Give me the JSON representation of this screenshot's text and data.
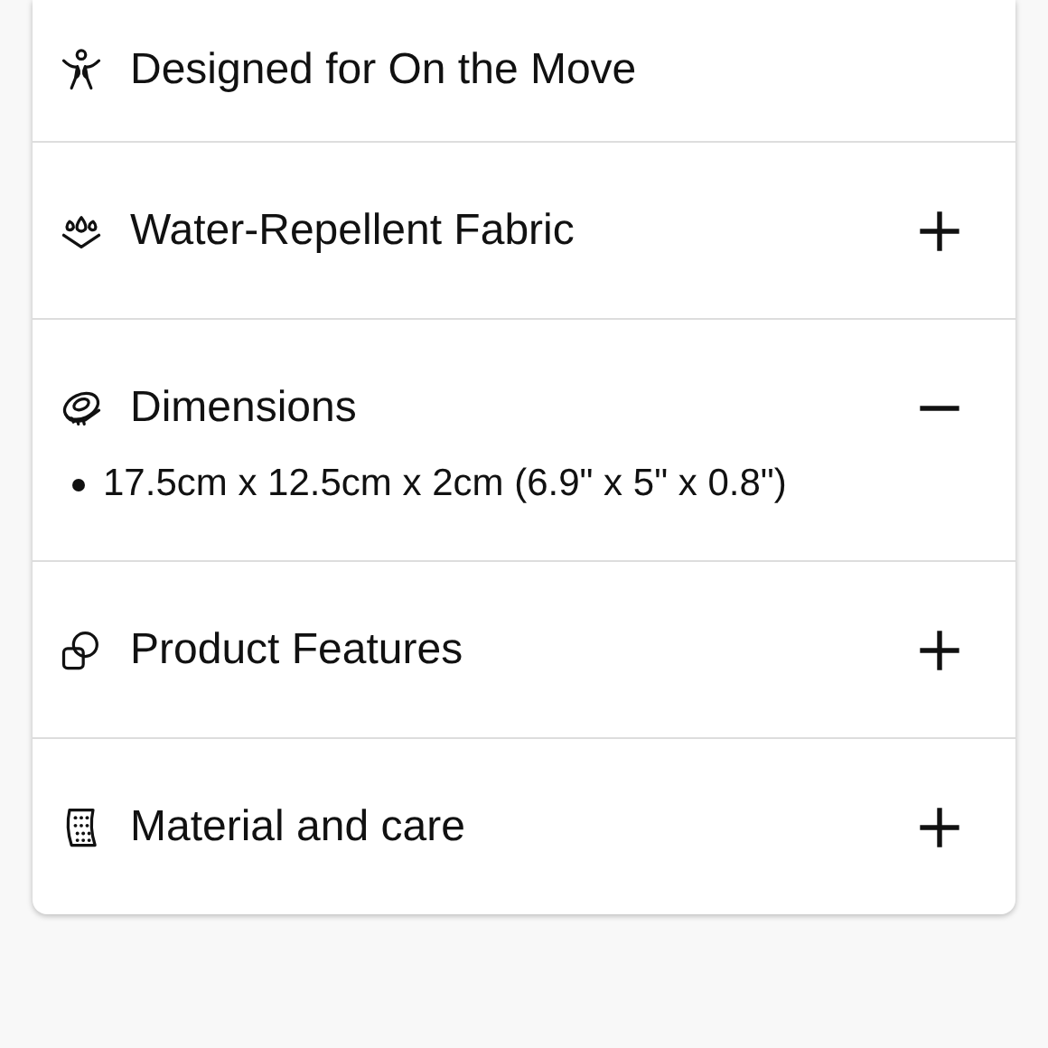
{
  "accordion": [
    {
      "kind": "static",
      "title": "Designed for On the Move"
    },
    {
      "kind": "toggle",
      "title": "Water-Repellent Fabric",
      "expanded": false
    },
    {
      "kind": "toggle",
      "title": "Dimensions",
      "expanded": true,
      "details": [
        "17.5cm x 12.5cm x 2cm (6.9\" x 5\" x 0.8\")"
      ]
    },
    {
      "kind": "toggle",
      "title": "Product Features",
      "expanded": false
    },
    {
      "kind": "toggle",
      "title": "Material and care",
      "expanded": false
    }
  ]
}
